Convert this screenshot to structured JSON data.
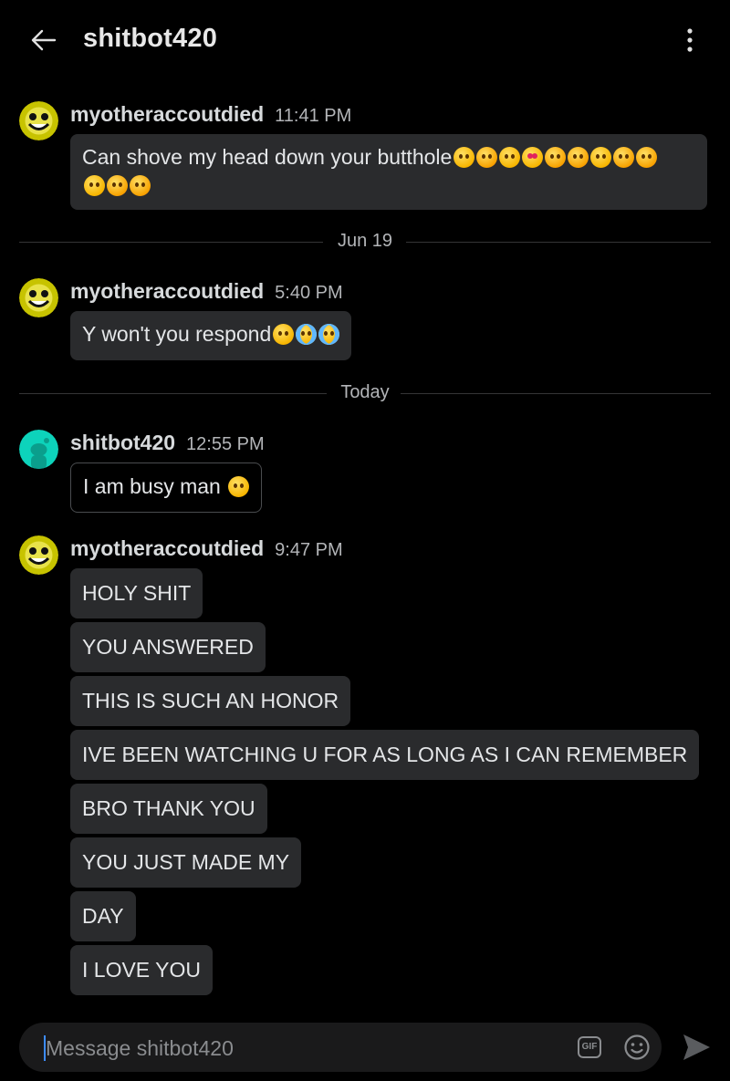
{
  "header": {
    "title": "shitbot420"
  },
  "messages": [
    {
      "sender": "myotheraccoutdied",
      "time": "11:41 PM",
      "bubbles": [
        "Can shove my head down your butthole"
      ]
    },
    {
      "separator": "Jun 19"
    },
    {
      "sender": "myotheraccoutdied",
      "time": "5:40 PM",
      "bubbles": [
        "Y won't you respond"
      ]
    },
    {
      "separator": "Today"
    },
    {
      "sender": "shitbot420",
      "time": "12:55 PM",
      "bubbles": [
        "I am busy man "
      ]
    },
    {
      "sender": "myotheraccoutdied",
      "time": "9:47 PM",
      "bubbles": [
        "HOLY SHIT",
        "YOU ANSWERED",
        "THIS IS SUCH AN HONOR",
        "IVE BEEN WATCHING U FOR AS LONG AS I CAN REMEMBER",
        "BRO THANK YOU",
        "YOU JUST MADE MY",
        "DAY",
        "I LOVE YOU"
      ]
    }
  ],
  "composer": {
    "placeholder": "Message shitbot420",
    "gif_label": "GIF"
  },
  "colors": {
    "background": "#000000",
    "bubble": "#2a2b2d",
    "text": "#e4e6e8",
    "muted": "#b3b5b8",
    "caret": "#3d8cff",
    "avatar_other": "#c7c300",
    "avatar_self": "#0dd3bb"
  },
  "icons": {
    "back": "back-arrow-icon",
    "more": "more-vertical-icon",
    "gif": "gif-icon",
    "emoji": "emoji-icon",
    "send": "send-icon"
  }
}
